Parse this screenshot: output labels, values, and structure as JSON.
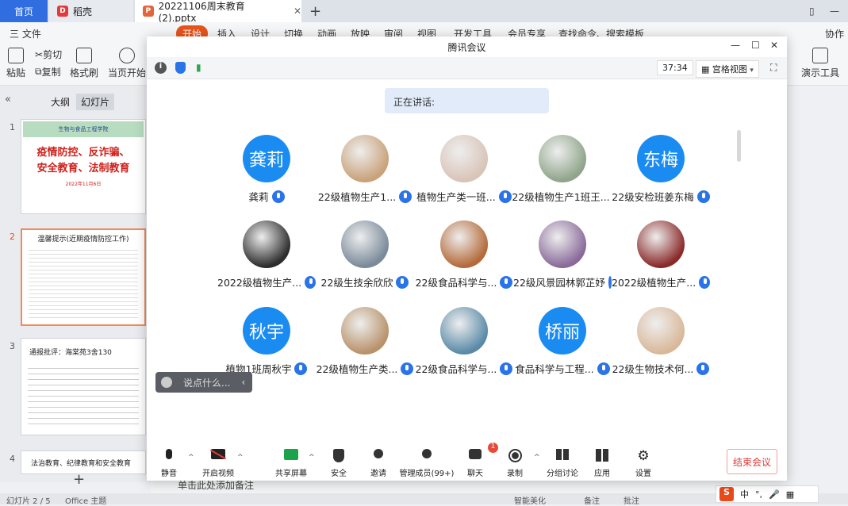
{
  "wps_tabs": {
    "home": "首页",
    "daoke": "稻壳",
    "file": "20221106周末教育 (2).pptx",
    "add": "+"
  },
  "menu": {
    "file": "三 文件",
    "start": "开始",
    "insert": "插入",
    "design": "设计",
    "switch": "切换",
    "animation": "动画",
    "slideshow": "放映",
    "review": "审阅",
    "view": "视图",
    "devtools": "开发工具",
    "member": "会员专享",
    "search": "查找命令、搜索模板",
    "collab": "协作"
  },
  "ribbon": {
    "paste": "粘贴",
    "cut": "剪切",
    "copy": "复制",
    "format_painter": "格式刷",
    "play_current": "当页开始",
    "presenter_tools": "演示工具"
  },
  "left_panel": {
    "outline_tab": "大纲",
    "slides_tab": "幻灯片",
    "add": "+",
    "slides": [
      {
        "num": "1",
        "header": "生物与食品工程学院",
        "title": "疫情防控、反诈骗、安全教育、法制教育",
        "date": "2022年11月6日"
      },
      {
        "num": "2",
        "title": "温馨提示(近期疫情防控工作)"
      },
      {
        "num": "3",
        "title": "通报批评：海棠苑3舍130"
      },
      {
        "num": "4",
        "title": "法治教育、纪律教育和安全教育"
      }
    ]
  },
  "notes_placeholder": "单击此处添加备注",
  "status": {
    "slide_count": "幻灯片 2 / 5",
    "theme": "Office 主题",
    "beautify": "智能美化",
    "notes": "备注",
    "comments": "批注"
  },
  "meeting": {
    "title": "腾讯会议",
    "timer": "37:34",
    "view_mode": "宫格视图",
    "speaking_label": "正在讲话:",
    "participants": [
      {
        "name": "龚莉",
        "avatar_text": "龚莉",
        "type": "text"
      },
      {
        "name": "22级植物生产1...",
        "type": "photo",
        "color": "#c9a27a"
      },
      {
        "name": "植物生产类一班...",
        "type": "photo",
        "color": "#d9c4b8"
      },
      {
        "name": "22级植物生产1班王...",
        "type": "photo",
        "color": "#8fa58a"
      },
      {
        "name": "22级安检班姜东梅",
        "avatar_text": "东梅",
        "type": "text"
      },
      {
        "name": "2022级植物生产...",
        "type": "photo",
        "color": "#2d2d2d"
      },
      {
        "name": "22级生技余欣欣",
        "type": "photo",
        "color": "#7a8a9a"
      },
      {
        "name": "22级食品科学与...",
        "type": "photo",
        "color": "#b46a3a"
      },
      {
        "name": "22级风景园林郭芷妤",
        "type": "photo",
        "color": "#8a6a9a"
      },
      {
        "name": "2022级植物生产...",
        "type": "photo",
        "color": "#8a2a2a"
      },
      {
        "name": "植物1班周秋宇",
        "avatar_text": "秋宇",
        "type": "text"
      },
      {
        "name": "22级植物生产类...",
        "type": "photo",
        "color": "#b8926a"
      },
      {
        "name": "22级食品科学与...",
        "type": "photo",
        "color": "#5a8aa8"
      },
      {
        "name": "食品科学与工程...",
        "avatar_text": "桥丽",
        "type": "text"
      },
      {
        "name": "22级生物技术何...",
        "type": "photo",
        "color": "#d9b89a"
      }
    ],
    "chat_placeholder": "说点什么...",
    "toolbar": {
      "mute": "静音",
      "video": "开启视频",
      "share": "共享屏幕",
      "security": "安全",
      "invite": "邀请",
      "members": "管理成员(99+)",
      "chat": "聊天",
      "chat_badge": "1",
      "record": "录制",
      "breakout": "分组讨论",
      "apps": "应用",
      "settings": "设置"
    },
    "end_label": "结束会议"
  },
  "ime": {
    "lang": "中"
  }
}
